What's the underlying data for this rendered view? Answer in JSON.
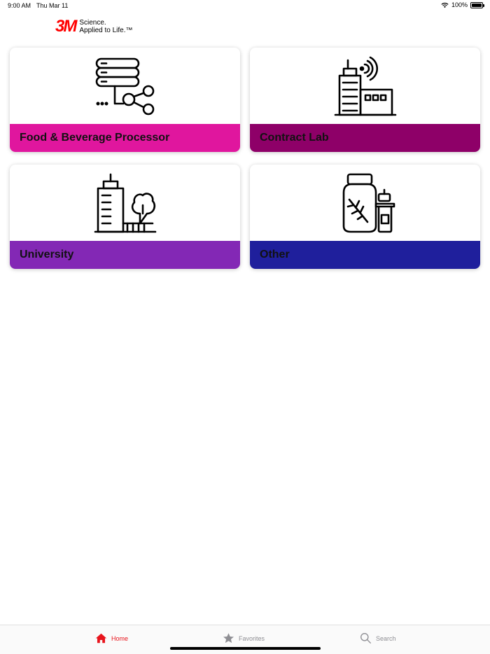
{
  "status_bar": {
    "time": "9:00 AM",
    "date": "Thu Mar 11",
    "battery": "100%",
    "wifi_icon": "wifi-icon",
    "battery_icon": "battery-icon"
  },
  "header": {
    "logo_text": "3M",
    "tagline_line1": "Science.",
    "tagline_line2": "Applied to Life.™",
    "brand_color": "#ff0000"
  },
  "cards": [
    {
      "label": "Food & Beverage Processor",
      "color": "#e0169e",
      "icon": "server-network-icon"
    },
    {
      "label": "Contract Lab",
      "color": "#8e0068",
      "icon": "lab-building-icon"
    },
    {
      "label": "University",
      "color": "#8328b5",
      "icon": "university-building-icon"
    },
    {
      "label": "Other",
      "color": "#1f1f9c",
      "icon": "jars-icon"
    }
  ],
  "tab_bar": {
    "tabs": [
      {
        "label": "Home",
        "icon": "home-icon",
        "active": true,
        "color": "#e8141c"
      },
      {
        "label": "Favorites",
        "icon": "star-icon",
        "active": false,
        "color": "#8e8e93"
      },
      {
        "label": "Search",
        "icon": "search-icon",
        "active": false,
        "color": "#8e8e93"
      }
    ]
  }
}
